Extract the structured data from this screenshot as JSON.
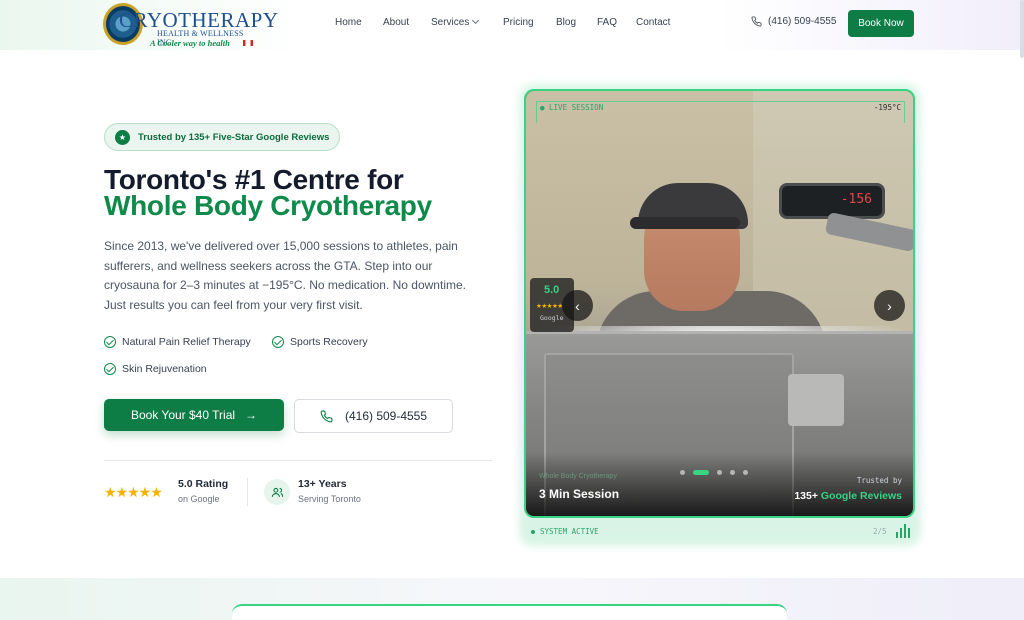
{
  "brand": {
    "title": "CRYOTHERAPY",
    "subtitle": "HEALTH & WELLNESS INC.",
    "tagline": "A Cooler way to health"
  },
  "nav": {
    "items": [
      {
        "label": "Home"
      },
      {
        "label": "About"
      },
      {
        "label": "Services",
        "has_dropdown": true
      },
      {
        "label": "Pricing"
      },
      {
        "label": "Blog"
      },
      {
        "label": "FAQ"
      },
      {
        "label": "Contact"
      }
    ],
    "phone": "(416) 509-4555",
    "book_label": "Book Now"
  },
  "hero": {
    "badge": "Trusted by 135+ Five-Star Google Reviews",
    "title_line1": "Toronto's #1 Centre for",
    "title_line2": "Whole Body Cryotherapy",
    "lead": "Since 2013, we've delivered over 15,000 sessions to athletes, pain sufferers, and wellness seekers across the GTA. Step into our cryosauna for 2–3 minutes at −195°C. No medication. No downtime. Just results you can feel from your very first visit.",
    "features": [
      "Natural Pain Relief Therapy",
      "Sports Recovery",
      "Skin Rejuvenation"
    ],
    "cta_primary": "Book Your $40 Trial",
    "cta_secondary": "(416) 509-4555",
    "rating": {
      "value": 5.0,
      "main": "5.0 Rating",
      "sub": "on Google",
      "stars": "★★★★★"
    },
    "years": {
      "main": "13+ Years",
      "sub": "Serving Toronto"
    }
  },
  "media": {
    "hud_left": "● LIVE SESSION",
    "hud_right": "-195°C",
    "display_reading": "-156",
    "google_badge": {
      "score": "5.0",
      "stars": "★★★★★",
      "name": "Google"
    },
    "slide_kicker": "Whole Body Cryotherapy",
    "slide_caption": "3 Min Session",
    "trusted_label": "Trusted by",
    "reviews_count": "135+",
    "reviews_label": "Google Reviews",
    "slides_total": 5,
    "active_slide": 2,
    "system_status": "SYSTEM ACTIVE",
    "slide_counter": "2/5"
  },
  "colors": {
    "brand_green": "#0e7c45",
    "accent_green": "#37d484",
    "star_gold": "#f5b301",
    "heading_dark": "#141b2d"
  }
}
